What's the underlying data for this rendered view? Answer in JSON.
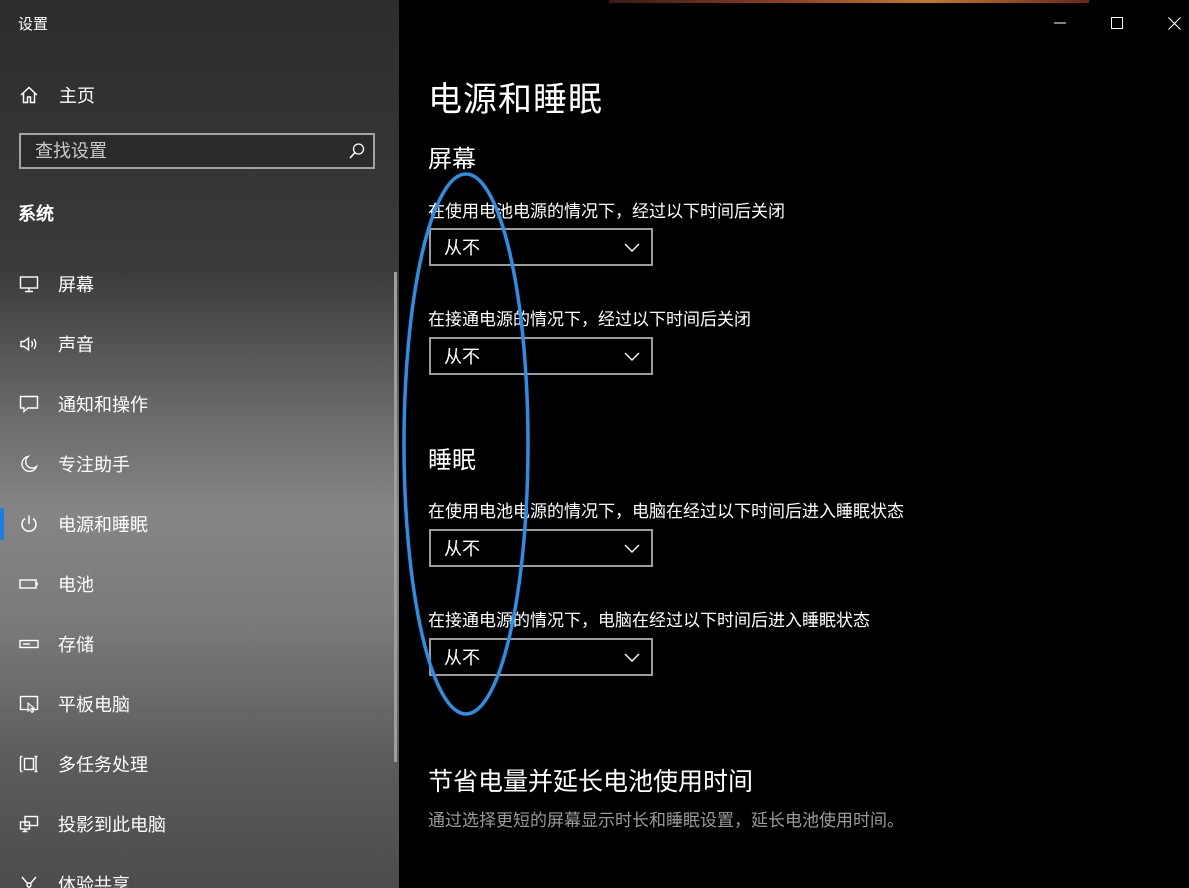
{
  "window": {
    "title": "设置",
    "minimize_label": "minimize",
    "maximize_label": "maximize",
    "close_label": "close"
  },
  "sidebar": {
    "home_label": "主页",
    "search_placeholder": "查找设置",
    "section_label": "系统",
    "items": [
      {
        "label": "屏幕",
        "icon": "monitor-icon"
      },
      {
        "label": "声音",
        "icon": "speaker-icon"
      },
      {
        "label": "通知和操作",
        "icon": "notification-icon"
      },
      {
        "label": "专注助手",
        "icon": "moon-icon"
      },
      {
        "label": "电源和睡眠",
        "icon": "power-icon",
        "active": true
      },
      {
        "label": "电池",
        "icon": "battery-icon"
      },
      {
        "label": "存储",
        "icon": "storage-icon"
      },
      {
        "label": "平板电脑",
        "icon": "tablet-icon"
      },
      {
        "label": "多任务处理",
        "icon": "multitask-icon"
      },
      {
        "label": "投影到此电脑",
        "icon": "project-icon"
      },
      {
        "label": "体验共享",
        "icon": "share-icon"
      }
    ]
  },
  "main": {
    "title": "电源和睡眠",
    "screen": {
      "heading": "屏幕",
      "battery_label": "在使用电池电源的情况下，经过以下时间后关闭",
      "battery_value": "从不",
      "plugged_label": "在接通电源的情况下，经过以下时间后关闭",
      "plugged_value": "从不"
    },
    "sleep": {
      "heading": "睡眠",
      "battery_label": "在使用电池电源的情况下，电脑在经过以下时间后进入睡眠状态",
      "battery_value": "从不",
      "plugged_label": "在接通电源的情况下，电脑在经过以下时间后进入睡眠状态",
      "plugged_value": "从不"
    },
    "save": {
      "heading": "节省电量并延长电池使用时间",
      "description": "通过选择更短的屏幕显示时长和睡眠设置，延长电池使用时间。"
    }
  },
  "colors": {
    "accent": "#1a7fe0",
    "annotation": "#2b8fe6"
  }
}
